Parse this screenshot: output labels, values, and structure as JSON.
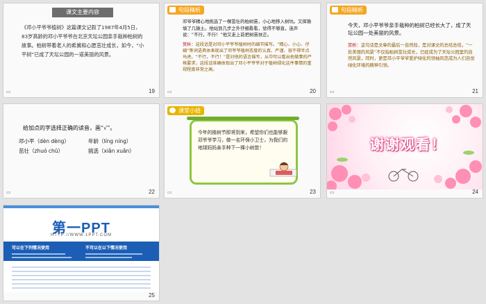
{
  "slides": [
    {
      "num": "19",
      "title": "课文主要内容",
      "body": "《邓小平爷爷植树》这篇课文记叙了1987年4月5日，83岁高龄的邓小平爷爷在北京天坛公园亲手栽种柏树的故事。柏树带着老人的希冀和心愿茁壮成长，如今，“小平树”已成了天坛公园的一道美丽的风景。"
    },
    {
      "num": "20",
      "tag": "句段精析",
      "body": "邓爷爷精心地挑选了一棵茁壮的柏树苗，小心地移入树坑。又挥锹填了几锹土。他站到几步之外仔细看看，觉得不够直，连声说：“不行，不行！”他又走上前把树苗扶正。",
      "label": "赏析：",
      "note": "这段话是对邓小平爷爷植树时的细节描写。“精心、小心、仔细”等词语具体表现出了邓爷爷植树态度的认真、严谨、容不得半点马虎。“不行，不行！”是对他的语言描写，从中可以看出他做事的严格要求，这段话准确体现出了邓小平爷爷对于植树绿化这件事情的重视程度非常之高。"
    },
    {
      "num": "21",
      "tag": "句段精析",
      "body": "今天，邓小平爷爷亲手栽种的柏树已经长大了，成了天坛公园一处美丽的风景。",
      "label": "赏析：",
      "note": "这句话是文章的最后一自然段，是对课文的总结总结。“一处美丽的风景”不仅指柏树茁壮成长，已经成为了天坛公园里的自然风景，同时，更是邓小平爷爷爱护绿化的领袖风范成为人们自觉绿化环境的精神引领。"
    },
    {
      "num": "22",
      "question": "给加点的字选择正确的读音，画“√”。",
      "rows": [
        [
          "邓小平（dèn dèng）",
          "年龄（líng níng）"
        ],
        [
          "茁壮（zhuó chū）",
          "挑选（xiǎn xuǎn）"
        ]
      ]
    },
    {
      "num": "23",
      "tag": "课堂小结",
      "body": "今年的植树节即将到来，希望你们也能够跟邓爷爷学习，做一名环保小卫士，为我们的地球妈妈亲手种下一棵小树苗！"
    },
    {
      "num": "24",
      "thanks": "谢谢观看！"
    },
    {
      "num": "25",
      "logo": "第一PPT",
      "url": "HTTP://WWW.1PPT.COM",
      "col1_title": "可以在下列情况使用",
      "col2_title": "不可以在以下情况使用"
    }
  ],
  "colors": {
    "accent": "#f5a623",
    "analysis_red": "#c0171a",
    "background": "#e3e3e3",
    "brand_blue": "#1c5eb5"
  }
}
